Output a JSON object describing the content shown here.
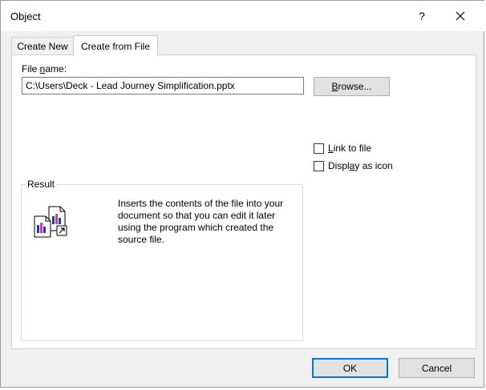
{
  "window": {
    "title": "Object",
    "help_label": "?"
  },
  "tabs": [
    {
      "label": "Create New",
      "active": false
    },
    {
      "label": "Create from File",
      "active": true
    }
  ],
  "panel": {
    "file_name_label_pre": "File ",
    "file_name_label_key": "n",
    "file_name_label_post": "ame:",
    "file_name_value": "C:\\Users\\Deck - Lead Journey Simplification.pptx",
    "browse_key": "B",
    "browse_rest": "rowse...",
    "link_to_file": {
      "key": "L",
      "rest": "ink to file",
      "checked": false
    },
    "display_as_icon": {
      "pre": "Displ",
      "key": "a",
      "post": "y as icon",
      "checked": false
    },
    "result": {
      "legend": "Result",
      "text": "Inserts the contents of the file into your document so that you can edit it later using the program which created the source file.",
      "icon": "embedded-document-icon"
    }
  },
  "footer": {
    "ok_label": "OK",
    "cancel_label": "Cancel"
  },
  "colors": {
    "dialog_bg": "#f0f0f0",
    "accent": "#0078d7",
    "button_bg": "#e1e1e1"
  }
}
